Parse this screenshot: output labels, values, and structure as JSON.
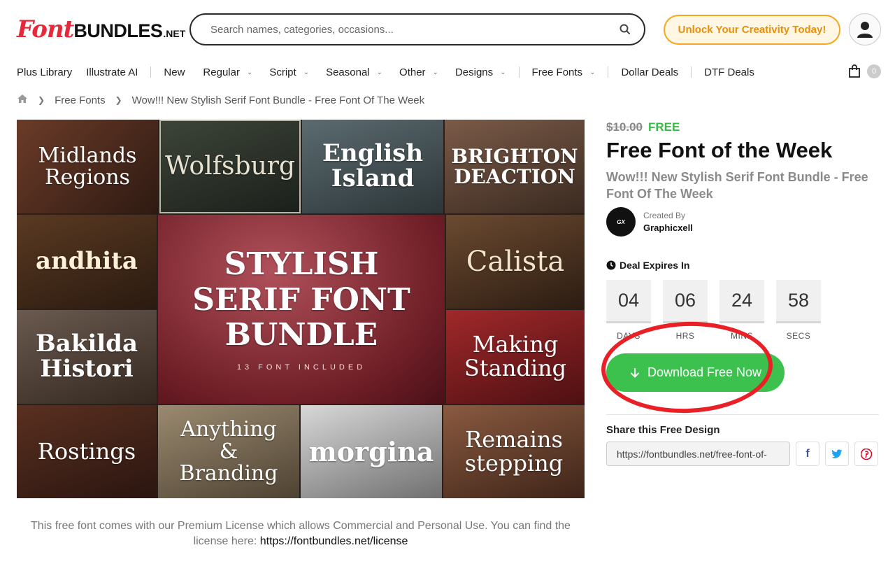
{
  "header": {
    "logo": {
      "font": "Font",
      "bundles": "BUNDLES",
      "net": ".NET"
    },
    "search_placeholder": "Search names, categories, occasions...",
    "unlock_label": "Unlock Your Creativity Today!"
  },
  "nav": {
    "items": [
      {
        "label": "Plus Library",
        "dropdown": false
      },
      {
        "label": "Illustrate AI",
        "dropdown": false
      },
      {
        "label": "New",
        "dropdown": false
      },
      {
        "label": "Regular",
        "dropdown": true
      },
      {
        "label": "Script",
        "dropdown": true
      },
      {
        "label": "Seasonal",
        "dropdown": true
      },
      {
        "label": "Other",
        "dropdown": true
      },
      {
        "label": "Designs",
        "dropdown": true
      },
      {
        "label": "Free Fonts",
        "dropdown": true
      },
      {
        "label": "Dollar Deals",
        "dropdown": false
      },
      {
        "label": "DTF Deals",
        "dropdown": false
      }
    ],
    "cart_count": "0"
  },
  "breadcrumb": {
    "items": [
      "Free Fonts",
      "Wow!!! New Stylish Serif Font Bundle - Free Font Of The Week"
    ]
  },
  "gallery": {
    "tiles": [
      {
        "text": "Midlands Regions"
      },
      {
        "text": "Wolfsburg"
      },
      {
        "text": "English Island"
      },
      {
        "text": "BRIGHTON DEACTION"
      },
      {
        "text": "andhita"
      },
      {
        "text": "STYLISH SERIF FONT BUNDLE"
      },
      {
        "text": "13 FONT INCLUDED"
      },
      {
        "text": "Calista"
      },
      {
        "text": "Bakilda Histori"
      },
      {
        "text": "Making Standing"
      },
      {
        "text": "Rostings"
      },
      {
        "text": "Anything & Branding"
      },
      {
        "text": "morgina"
      },
      {
        "text": "Remains stepping"
      }
    ]
  },
  "product": {
    "old_price": "$10.00",
    "price": "FREE",
    "title": "Free Font of the Week",
    "subtitle": "Wow!!! New Stylish Serif Font Bundle - Free Font Of The Week",
    "created_by_label": "Created By",
    "creator": "Graphicxell"
  },
  "deal": {
    "label": "Deal Expires In",
    "countdown": [
      {
        "value": "04",
        "unit": "DAYS"
      },
      {
        "value": "06",
        "unit": "HRS"
      },
      {
        "value": "24",
        "unit": "MINS"
      },
      {
        "value": "58",
        "unit": "SECS"
      }
    ]
  },
  "download_label": "Download Free Now",
  "share": {
    "title": "Share this Free Design",
    "url": "https://fontbundles.net/free-font-of-"
  },
  "license": {
    "text": "This free font comes with our Premium License which allows Commercial and Personal Use. You can find the license here: ",
    "link": "https://fontbundles.net/license"
  },
  "colors": {
    "accent_red": "#e5283a",
    "free_green": "#3cb648",
    "button_green": "#3cc14f",
    "unlock_orange": "#f4a823",
    "annotation_red": "#ea2027"
  }
}
